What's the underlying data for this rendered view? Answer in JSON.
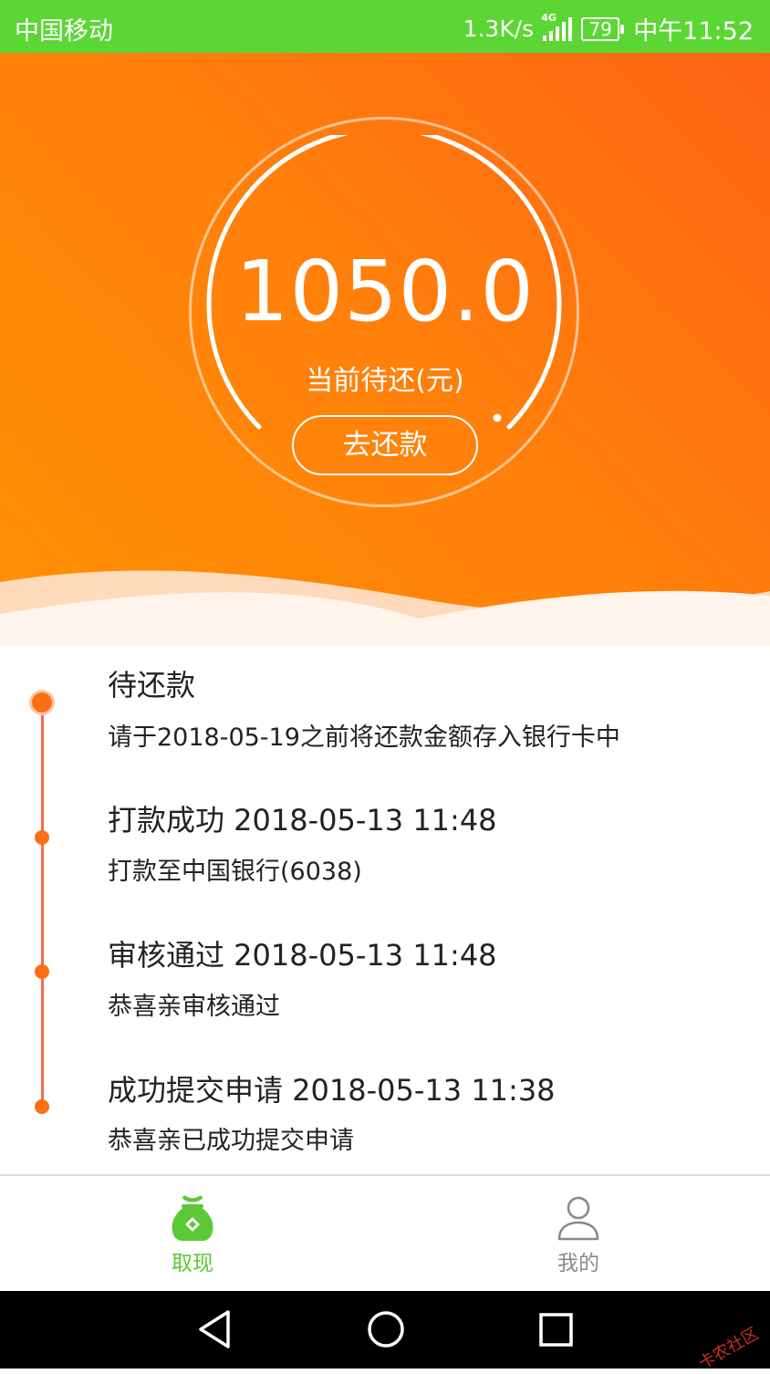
{
  "status_bar": {
    "carrier": "中国移动",
    "net_speed": "1.3K/s",
    "network_type": "4G",
    "battery": "79",
    "time": "中午11:52"
  },
  "hero": {
    "amount": "1050.0",
    "amount_label": "当前待还(元)",
    "repay_button": "去还款"
  },
  "timeline": [
    {
      "title": "待还款",
      "desc": "请于2018-05-19之前将还款金额存入银行卡中"
    },
    {
      "title": "打款成功 2018-05-13 11:48",
      "desc": "打款至中国银行(6038)"
    },
    {
      "title": "审核通过 2018-05-13 11:48",
      "desc": "恭喜亲审核通过"
    },
    {
      "title": "成功提交申请 2018-05-13 11:38",
      "desc": "恭喜亲已成功提交申请"
    }
  ],
  "tabbar": {
    "tabs": [
      {
        "label": "取现",
        "icon": "money-bag-icon",
        "active": true
      },
      {
        "label": "我的",
        "icon": "person-icon",
        "active": false
      }
    ]
  },
  "colors": {
    "status_bar": "#5bd635",
    "accent": "#fb6f16",
    "tab_active": "#5bc936",
    "tab_inactive": "#8a8a8a"
  },
  "watermark": "卡农社区"
}
